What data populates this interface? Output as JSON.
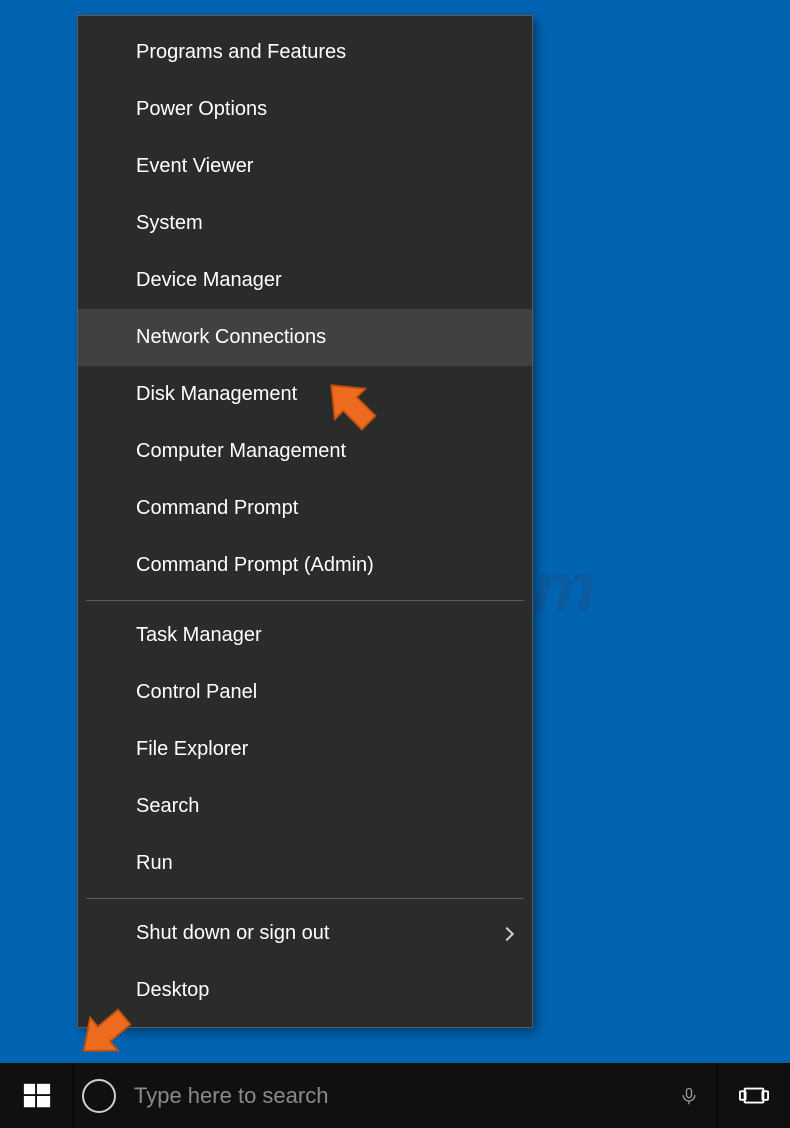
{
  "menu": {
    "items_group1": [
      {
        "label": "Programs and Features",
        "name": "programs-and-features",
        "hovered": false,
        "submenu": false
      },
      {
        "label": "Power Options",
        "name": "power-options",
        "hovered": false,
        "submenu": false
      },
      {
        "label": "Event Viewer",
        "name": "event-viewer",
        "hovered": false,
        "submenu": false
      },
      {
        "label": "System",
        "name": "system",
        "hovered": false,
        "submenu": false
      },
      {
        "label": "Device Manager",
        "name": "device-manager",
        "hovered": false,
        "submenu": false
      },
      {
        "label": "Network Connections",
        "name": "network-connections",
        "hovered": true,
        "submenu": false
      },
      {
        "label": "Disk Management",
        "name": "disk-management",
        "hovered": false,
        "submenu": false
      },
      {
        "label": "Computer Management",
        "name": "computer-management",
        "hovered": false,
        "submenu": false
      },
      {
        "label": "Command Prompt",
        "name": "command-prompt",
        "hovered": false,
        "submenu": false
      },
      {
        "label": "Command Prompt (Admin)",
        "name": "command-prompt-admin",
        "hovered": false,
        "submenu": false
      }
    ],
    "items_group2": [
      {
        "label": "Task Manager",
        "name": "task-manager",
        "hovered": false,
        "submenu": false
      },
      {
        "label": "Control Panel",
        "name": "control-panel",
        "hovered": false,
        "submenu": false
      },
      {
        "label": "File Explorer",
        "name": "file-explorer",
        "hovered": false,
        "submenu": false
      },
      {
        "label": "Search",
        "name": "search",
        "hovered": false,
        "submenu": false
      },
      {
        "label": "Run",
        "name": "run",
        "hovered": false,
        "submenu": false
      }
    ],
    "items_group3": [
      {
        "label": "Shut down or sign out",
        "name": "shut-down-or-sign-out",
        "hovered": false,
        "submenu": true
      },
      {
        "label": "Desktop",
        "name": "desktop",
        "hovered": false,
        "submenu": false
      }
    ]
  },
  "taskbar": {
    "search_placeholder": "Type here to search"
  },
  "watermark": "PCrisk.com",
  "colors": {
    "desktop_bg": "#0064b3",
    "menu_bg": "#2b2b2b",
    "menu_hover": "#414141",
    "arrow": "#ed6b1f"
  }
}
